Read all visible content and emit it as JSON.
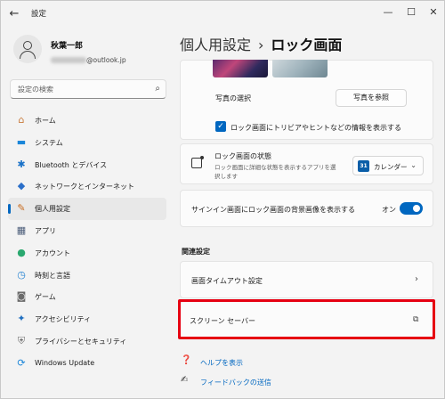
{
  "window": {
    "title": "設定",
    "controls": {
      "minimize": "—",
      "maximize": "☐",
      "close": "✕"
    }
  },
  "profile": {
    "name": "秋葉一郎",
    "email": "@outlook.jp"
  },
  "search": {
    "placeholder": "設定の検索"
  },
  "sidebar": {
    "items": [
      {
        "label": "ホーム",
        "icon": "home-icon",
        "glyph": "⌂",
        "color": "#c97b3c",
        "active": false
      },
      {
        "label": "システム",
        "icon": "system-icon",
        "glyph": "▬",
        "color": "#1a86d9",
        "active": false
      },
      {
        "label": "Bluetooth とデバイス",
        "icon": "bluetooth-icon",
        "glyph": "✱",
        "color": "#1a72c8",
        "active": false
      },
      {
        "label": "ネットワークとインターネット",
        "icon": "network-icon",
        "glyph": "◆",
        "color": "#2a6fc9",
        "active": false
      },
      {
        "label": "個人用設定",
        "icon": "personalization-icon",
        "glyph": "✎",
        "color": "#c86b1e",
        "active": true
      },
      {
        "label": "アプリ",
        "icon": "apps-icon",
        "glyph": "▦",
        "color": "#4c5e7a",
        "active": false
      },
      {
        "label": "アカウント",
        "icon": "account-icon",
        "glyph": "●",
        "color": "#2aa86f",
        "active": false
      },
      {
        "label": "時刻と言語",
        "icon": "time-language-icon",
        "glyph": "◷",
        "color": "#1f7fd0",
        "active": false
      },
      {
        "label": "ゲーム",
        "icon": "gaming-icon",
        "glyph": "◙",
        "color": "#6b6b6b",
        "active": false
      },
      {
        "label": "アクセシビリティ",
        "icon": "accessibility-icon",
        "glyph": "✦",
        "color": "#1f6fc0",
        "active": false
      },
      {
        "label": "プライバシーとセキュリティ",
        "icon": "privacy-shield-icon",
        "glyph": "⛨",
        "color": "#707070",
        "active": false
      },
      {
        "label": "Windows Update",
        "icon": "windows-update-icon",
        "glyph": "⟳",
        "color": "#1a86d9",
        "active": false
      }
    ]
  },
  "breadcrumb": {
    "parent": "個人用設定",
    "separator": "›",
    "current": "ロック画面"
  },
  "photo_card": {
    "label": "写真の選択",
    "browse_button": "写真を参照",
    "checkbox_label": "ロック画面にトリビアやヒントなどの情報を表示する",
    "checkbox_checked": true
  },
  "status_card": {
    "title": "ロック画面の状態",
    "description_line1": "ロック画面に詳細な状態を表示するアプリを選",
    "description_line2": "択します",
    "dropdown_icon_text": "31",
    "dropdown_value": "カレンダー"
  },
  "signin_card": {
    "label": "サインイン画面にロック画面の背景画像を表示する",
    "toggle_state": "オン",
    "toggle_on": true
  },
  "related": {
    "heading": "関連設定",
    "items": [
      {
        "label": "画面タイムアウト設定"
      },
      {
        "label": "スクリーン セーバー"
      }
    ]
  },
  "footer_links": {
    "help": "ヘルプを表示",
    "feedback": "フィードバックの送信"
  },
  "colors": {
    "accent": "#0067c0",
    "highlight_box": "#e60012"
  }
}
